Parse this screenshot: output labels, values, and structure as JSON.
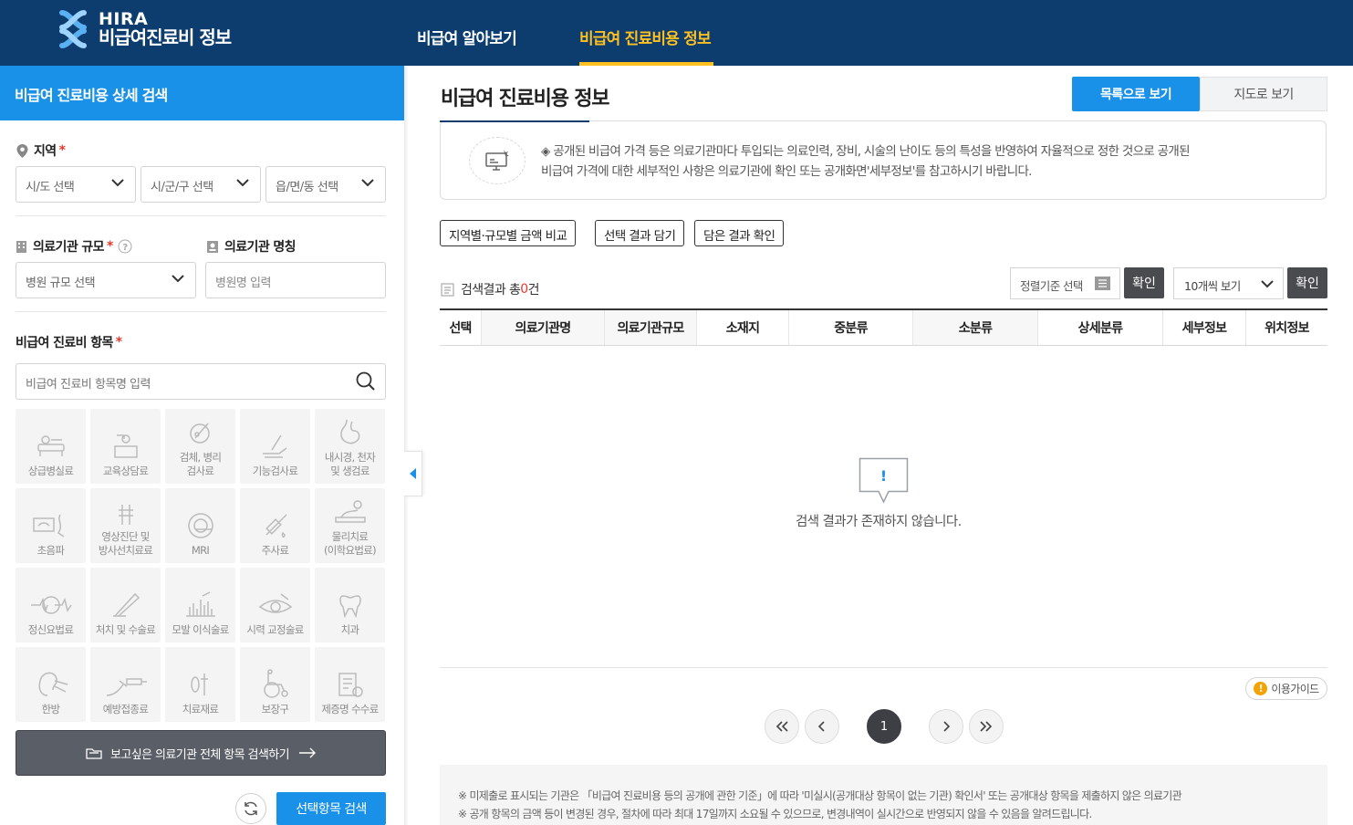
{
  "header": {
    "logo_line1": "HIRA",
    "logo_line2": "비급여진료비 정보",
    "nav": [
      "비급여 알아보기",
      "비급여 진료비용 정보"
    ],
    "active_color": "#ffc021",
    "bg_color": "#0c3d6e"
  },
  "left": {
    "title": "비급여 진료비용 상세 검색",
    "region_label": "지역",
    "region_selects": [
      "시/도 선택",
      "시/군/구 선택",
      "읍/면/동 선택"
    ],
    "scale_label": "의료기관 규모",
    "scale_select": "병원 규모 선택",
    "name_label": "의료기관 명칭",
    "name_placeholder": "병원명 입력",
    "item_label": "비급여 진료비 항목",
    "item_placeholder": "비급여 진료비 항목명 입력",
    "categories": [
      {
        "label": "상급병실료",
        "icon": "bed-icon"
      },
      {
        "label": "교육상담료",
        "icon": "consult-icon"
      },
      {
        "label": "검체, 병리\n검사료",
        "icon": "specimen-icon"
      },
      {
        "label": "기능검사료",
        "icon": "hand-test-icon"
      },
      {
        "label": "내시경, 천자\n및 생검료",
        "icon": "stomach-icon"
      },
      {
        "label": "초음파",
        "icon": "ultrasound-icon"
      },
      {
        "label": "영상진단 및\n방사선치료료",
        "icon": "xray-icon"
      },
      {
        "label": "MRI",
        "icon": "mri-icon"
      },
      {
        "label": "주사료",
        "icon": "syringe-icon"
      },
      {
        "label": "물리치료\n(이학요법료)",
        "icon": "therapy-icon"
      },
      {
        "label": "정신요법료",
        "icon": "brain-icon"
      },
      {
        "label": "처치 및 수술료",
        "icon": "scalpel-icon"
      },
      {
        "label": "모발 이식술료",
        "icon": "hair-icon"
      },
      {
        "label": "시력 교정술료",
        "icon": "eye-icon"
      },
      {
        "label": "치과",
        "icon": "tooth-icon"
      },
      {
        "label": "한방",
        "icon": "acupuncture-icon"
      },
      {
        "label": "예방접종료",
        "icon": "vaccine-icon"
      },
      {
        "label": "치료재료",
        "icon": "material-icon"
      },
      {
        "label": "보장구",
        "icon": "wheelchair-icon"
      },
      {
        "label": "제증명 수수료",
        "icon": "certificate-icon"
      }
    ],
    "all_search_label": "보고싶은 의료기관 전체 항목 검색하기",
    "search_button": "선택항목 검색"
  },
  "main": {
    "title": "비급여 진료비용 정보",
    "view_list": "목록으로 보기",
    "view_map": "지도로 보기",
    "notice_line1": "◈ 공개된 비급여 가격 등은 의료기관마다 투입되는 의료인력, 장비, 시술의 난이도 등의 특성을 반영하여 자율적으로 정한 것으로 공개된",
    "notice_line2": "비급여 가격에 대한 세부적인 사항은 의료기관에 확인 또는 공개화면'세부정보'를 참고하시기 바랍니다.",
    "actions": [
      "지역별·규모별 금액 비교",
      "선택 결과 담기",
      "담은 결과 확인"
    ],
    "result_prefix": "검색결과 총",
    "result_count": "0",
    "result_suffix": "건",
    "sort_select": "정렬기준 선택",
    "confirm": "확인",
    "per_page": "10개씩 보기",
    "columns": [
      "선택",
      "의료기관명",
      "의료기관규모",
      "소재지",
      "중분류",
      "소분류",
      "상세분류",
      "세부정보",
      "위치정보"
    ],
    "empty_message": "검색 결과가 존재하지 않습니다.",
    "guide": "이용가이드",
    "current_page": "1",
    "footnote1": "※ 미제출로 표시되는 기관은 「비급여 진료비용 등의 공개에 관한 기준」에 따라 '미실시(공개대상 항목이 없는 기관) 확인서' 또는 공개대상 항목을 제출하지 않은 의료기관",
    "footnote2": "※ 공개 항목의 금액 등이 변경된 경우, 절차에 따라 최대 17일까지 소요될 수 있으므로, 변경내역이 실시간으로 반영되지 않을 수 있음을 알려드립니다."
  }
}
